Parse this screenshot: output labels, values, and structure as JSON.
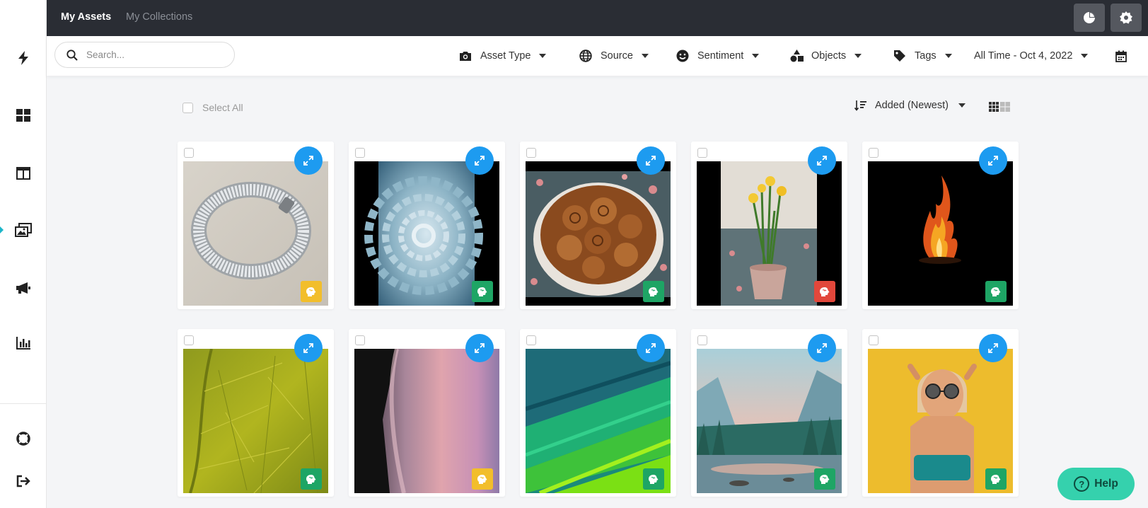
{
  "topbar": {
    "tabs": [
      {
        "label": "My Assets",
        "active": true
      },
      {
        "label": "My Collections",
        "active": false
      }
    ],
    "right_buttons": [
      "pie-chart-icon",
      "gear-icon"
    ]
  },
  "sidebar": {
    "items": [
      "bolt-icon",
      "dashboard-icon",
      "layout-icon",
      "media-assets-icon",
      "megaphone-icon",
      "bar-chart-icon"
    ],
    "active_item": "media-assets-icon",
    "bottom_items": [
      "help-lifebuoy-icon",
      "logout-icon"
    ]
  },
  "search": {
    "placeholder": "Search..."
  },
  "filters": [
    {
      "label": "Asset Type",
      "icon": "camera-icon"
    },
    {
      "label": "Source",
      "icon": "globe-icon"
    },
    {
      "label": "Sentiment",
      "icon": "smile-icon"
    },
    {
      "label": "Objects",
      "icon": "shapes-icon"
    },
    {
      "label": "Tags",
      "icon": "tag-icon"
    }
  ],
  "date_range": {
    "label": "All Time - Oct 4, 2022"
  },
  "toolbar": {
    "select_all_label": "Select All",
    "sort_label": "Added (Newest)"
  },
  "colors": {
    "accent": "#1d9bf0",
    "sentiment_positive": "#1ea565",
    "sentiment_neutral": "#f2be2b",
    "sentiment_negative": "#e2473b",
    "help_bg": "#35d1ad"
  },
  "assets": [
    {
      "subject": "white knitted bracelet",
      "sentiment": "neutral"
    },
    {
      "subject": "blue frost crystal spiral",
      "sentiment": "positive"
    },
    {
      "subject": "cinnamon roll cake",
      "sentiment": "positive"
    },
    {
      "subject": "daffodils in pot",
      "sentiment": "negative"
    },
    {
      "subject": "fire on black",
      "sentiment": "positive"
    },
    {
      "subject": "green leaf texture",
      "sentiment": "positive"
    },
    {
      "subject": "pink abstract streak",
      "sentiment": "neutral"
    },
    {
      "subject": "green teal abstract paint",
      "sentiment": "positive"
    },
    {
      "subject": "mountain lake landscape",
      "sentiment": "positive"
    },
    {
      "subject": "woman with sunglasses yellow wall",
      "sentiment": "positive"
    }
  ],
  "help": {
    "label": "Help"
  }
}
